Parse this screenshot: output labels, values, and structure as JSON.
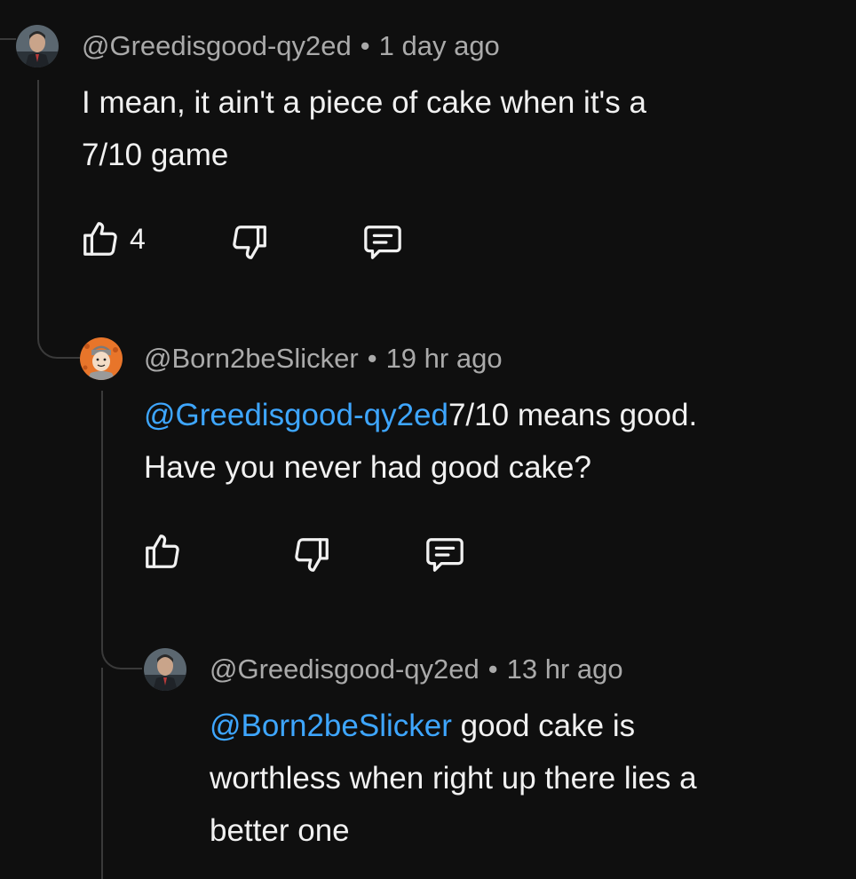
{
  "comments": [
    {
      "handle": "@Greedisgood-qy2ed",
      "time": "1 day ago",
      "text_line1": "I mean, it ain't a piece of cake when it's a",
      "text_line2": "7/10 game",
      "likes": "4",
      "avatar_icon": "suited-man-avatar"
    },
    {
      "handle": "@Born2beSlicker",
      "time": "19 hr ago",
      "mention": "@Greedisgood-qy2ed",
      "text_after_mention": "7/10 means good.",
      "text_line2": "Have you never had good cake?",
      "avatar_icon": "orange-cartoon-avatar"
    },
    {
      "handle": "@Greedisgood-qy2ed",
      "time": "13 hr ago",
      "mention": "@Born2beSlicker",
      "text_after_mention": " good cake is",
      "text_line2": "worthless when right up there lies a",
      "text_line3": "better one",
      "avatar_icon": "suited-man-avatar"
    }
  ],
  "separator": "•",
  "icons": {
    "like": "thumbs-up-icon",
    "dislike": "thumbs-down-icon",
    "reply": "reply-comment-icon"
  },
  "colors": {
    "background": "#0f0f0f",
    "text": "#f1f1f1",
    "meta": "#aaaaaa",
    "mention": "#3ea6ff",
    "thread_line": "#3a3a3a"
  }
}
